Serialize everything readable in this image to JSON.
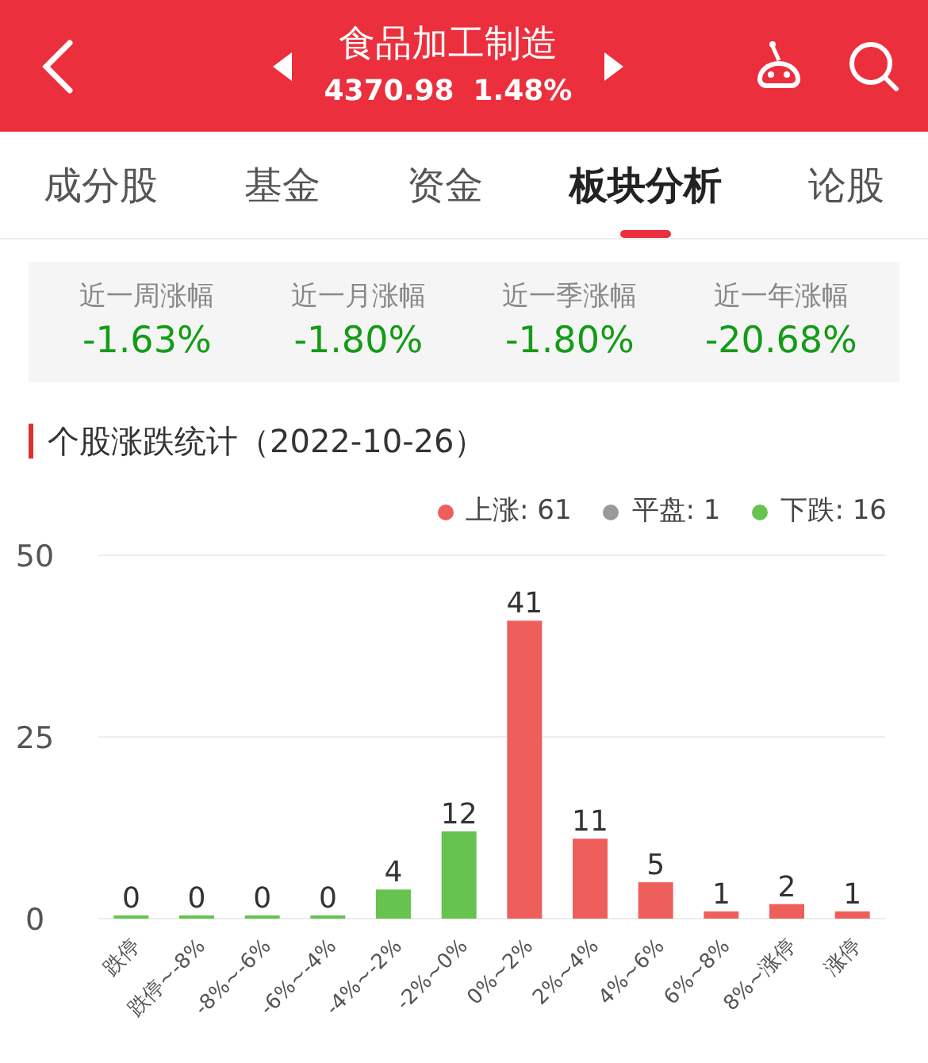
{
  "header": {
    "title": "食品加工制造",
    "price": "4370.98",
    "change": "1.48%"
  },
  "tabs": [
    {
      "label": "成分股",
      "selected": false
    },
    {
      "label": "基金",
      "selected": false
    },
    {
      "label": "资金",
      "selected": false
    },
    {
      "label": "板块分析",
      "selected": true
    },
    {
      "label": "论股",
      "selected": false
    }
  ],
  "stats": [
    {
      "label": "近一周涨幅",
      "value": "-1.63%"
    },
    {
      "label": "近一月涨幅",
      "value": "-1.80%"
    },
    {
      "label": "近一季涨幅",
      "value": "-1.80%"
    },
    {
      "label": "近一年涨幅",
      "value": "-20.68%"
    }
  ],
  "section_title": "个股涨跌统计（2022-10-26）",
  "legend": [
    {
      "label": "上涨: 61",
      "color": "#ee5f5b"
    },
    {
      "label": "平盘: 1",
      "color": "#999999"
    },
    {
      "label": "下跌: 16",
      "color": "#66c350"
    }
  ],
  "chart_data": {
    "type": "bar",
    "categories": [
      "跌停",
      "跌停~-8%",
      "-8%~-6%",
      "-6%~-4%",
      "-4%~-2%",
      "-2%~0%",
      "0%~2%",
      "2%~4%",
      "4%~6%",
      "6%~8%",
      "8%~涨停",
      "涨停"
    ],
    "series": [
      {
        "color": "#66c350",
        "values": [
          0,
          0,
          0,
          0,
          4,
          12,
          null,
          null,
          null,
          null,
          null,
          null
        ]
      },
      {
        "color": "#ee5f5b",
        "values": [
          null,
          null,
          null,
          null,
          null,
          null,
          41,
          11,
          5,
          1,
          2,
          1
        ]
      }
    ],
    "ylim": [
      0,
      50
    ],
    "yticks": [
      0,
      25,
      50
    ],
    "data_labels": true
  }
}
